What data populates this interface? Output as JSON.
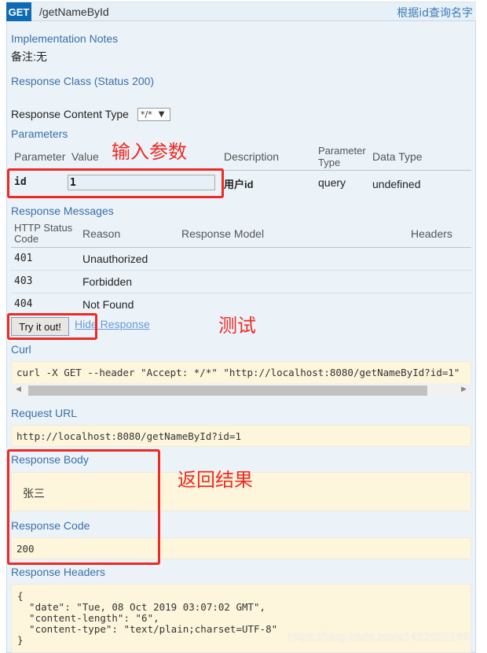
{
  "operation": {
    "method": "GET",
    "path": "/getNameById",
    "summary": "根据id查询名字"
  },
  "implementation_notes": {
    "title": "Implementation Notes",
    "text": "备注:无"
  },
  "response_class": {
    "title": "Response Class (Status 200)"
  },
  "response_content_type": {
    "label": "Response Content Type",
    "selected": "*/*"
  },
  "parameters": {
    "title": "Parameters",
    "headers": {
      "parameter": "Parameter",
      "value": "Value",
      "description": "Description",
      "parameter_type_line1": "Parameter",
      "parameter_type_line2": "Type",
      "data_type": "Data Type"
    },
    "rows": [
      {
        "name": "id",
        "value": "1",
        "description": "用户id",
        "parameter_type": "query",
        "data_type": "undefined"
      }
    ]
  },
  "response_messages": {
    "title": "Response Messages",
    "headers": {
      "status_line1": "HTTP Status",
      "status_line2": "Code",
      "reason": "Reason",
      "response_model": "Response Model",
      "headers": "Headers"
    },
    "rows": [
      {
        "code": "401",
        "reason": "Unauthorized"
      },
      {
        "code": "403",
        "reason": "Forbidden"
      },
      {
        "code": "404",
        "reason": "Not Found"
      }
    ]
  },
  "actions": {
    "try_label": "Try it out!",
    "hide_label": "Hide Response"
  },
  "curl": {
    "title": "Curl",
    "command": "curl -X GET --header \"Accept: */*\" \"http://localhost:8080/getNameById?id=1\""
  },
  "request_url": {
    "title": "Request URL",
    "value": "http://localhost:8080/getNameById?id=1"
  },
  "response_body": {
    "title": "Response Body",
    "value": "张三"
  },
  "response_code": {
    "title": "Response Code",
    "value": "200"
  },
  "response_headers": {
    "title": "Response Headers",
    "value": "{\n  \"date\": \"Tue, 08 Oct 2019 03:07:02 GMT\",\n  \"content-length\": \"6\",\n  \"content-type\": \"text/plain;charset=UTF-8\"\n}"
  },
  "annotations": {
    "input_params": "输入参数",
    "test": "测试",
    "return_result": "返回结果",
    "color": "#ee2a24"
  },
  "watermark": "https://blog.csdn.net/a1422655169",
  "colors": {
    "method_badge": "#0f6ab4",
    "panel_bg": "#ebf3f9",
    "code_bg": "#fdf6dc",
    "section_title": "#3b6fa8"
  }
}
